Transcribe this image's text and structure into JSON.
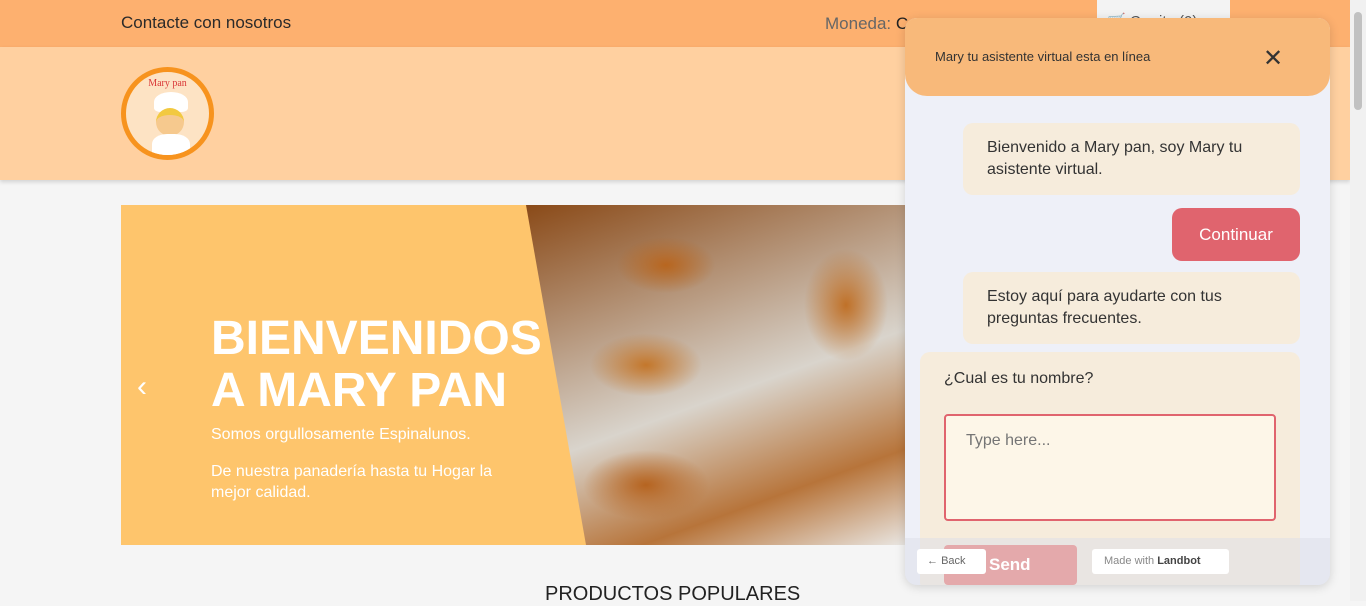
{
  "topbar": {
    "contact": "Contacte con nosotros",
    "currency_label": "Moneda:",
    "currency_value": "C",
    "cart": "Carrito (0)"
  },
  "logo": {
    "text": "Mary pan"
  },
  "hero": {
    "title_line1": "BIENVENIDOS",
    "title_line2": "A MARY PAN",
    "sub1": "Somos orgullosamente Espinalunos.",
    "sub2": "De nuestra panadería hasta tu Hogar la mejor calidad.",
    "prev": "‹"
  },
  "section": {
    "title": "PRODUCTOS POPULARES"
  },
  "chat": {
    "header": "Mary tu asistente virtual esta en línea",
    "close": "✕",
    "messages": [
      "Bienvenido a Mary pan, soy Mary tu asistente virtual.",
      "Estoy aquí para ayudarte con tus preguntas frecuentes."
    ],
    "continue": "Continuar",
    "question": "¿Cual es tu nombre?",
    "placeholder": "Type here...",
    "send": "Send",
    "back": "Back",
    "back_icon": "←",
    "made_with": "Made with",
    "brand": "Landbot"
  }
}
